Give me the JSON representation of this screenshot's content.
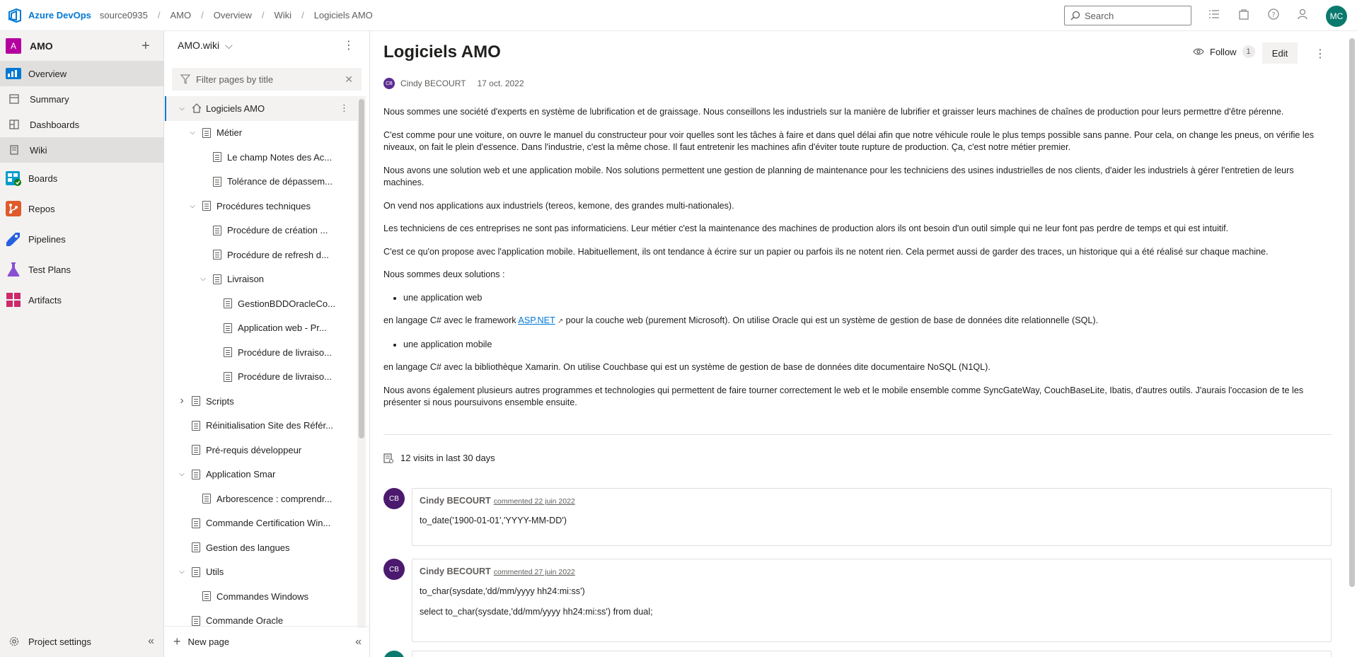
{
  "topbar": {
    "brand": "Azure DevOps",
    "breadcrumb": [
      "source0935",
      "AMO",
      "Overview",
      "Wiki",
      "Logiciels AMO"
    ],
    "search_placeholder": "Search",
    "user_initials": "MC"
  },
  "nav": {
    "project_initial": "A",
    "project_name": "AMO",
    "items": [
      {
        "label": "Overview",
        "icon": "overview-icon"
      },
      {
        "label": "Summary",
        "icon": "summary-icon"
      },
      {
        "label": "Dashboards",
        "icon": "dashboards-icon"
      },
      {
        "label": "Wiki",
        "icon": "wiki-icon"
      },
      {
        "label": "Boards",
        "icon": "boards-icon"
      },
      {
        "label": "Repos",
        "icon": "repos-icon"
      },
      {
        "label": "Pipelines",
        "icon": "pipelines-icon"
      },
      {
        "label": "Test Plans",
        "icon": "test-plans-icon"
      },
      {
        "label": "Artifacts",
        "icon": "artifacts-icon"
      }
    ],
    "project_settings": "Project settings"
  },
  "wiki": {
    "name": "AMO.wiki",
    "filter_placeholder": "Filter pages by title",
    "tree": [
      {
        "label": "Logiciels AMO",
        "indent": 0,
        "chevron": "down",
        "home": true,
        "selected": true
      },
      {
        "label": "Métier",
        "indent": 1,
        "chevron": "down"
      },
      {
        "label": "Le champ Notes des Ac...",
        "indent": 2,
        "chevron": ""
      },
      {
        "label": "Tolérance de dépassem...",
        "indent": 2,
        "chevron": ""
      },
      {
        "label": "Procédures techniques",
        "indent": 1,
        "chevron": "down"
      },
      {
        "label": "Procédure de création ...",
        "indent": 2,
        "chevron": ""
      },
      {
        "label": "Procédure de refresh d...",
        "indent": 2,
        "chevron": ""
      },
      {
        "label": "Livraison",
        "indent": 2,
        "chevron": "down"
      },
      {
        "label": "GestionBDDOracleCo...",
        "indent": 3,
        "chevron": ""
      },
      {
        "label": "Application web - Pr...",
        "indent": 3,
        "chevron": ""
      },
      {
        "label": "Procédure de livraiso...",
        "indent": 3,
        "chevron": ""
      },
      {
        "label": "Procédure de livraiso...",
        "indent": 3,
        "chevron": ""
      },
      {
        "label": "Scripts",
        "indent": 0,
        "chevron": "right"
      },
      {
        "label": "Réinitialisation Site des Référ...",
        "indent": 0,
        "chevron": ""
      },
      {
        "label": "Pré-requis développeur",
        "indent": 0,
        "chevron": ""
      },
      {
        "label": "Application Smar",
        "indent": 0,
        "chevron": "down"
      },
      {
        "label": "Arborescence : comprendr...",
        "indent": 1,
        "chevron": ""
      },
      {
        "label": "Commande Certification Win...",
        "indent": 0,
        "chevron": ""
      },
      {
        "label": "Gestion des langues",
        "indent": 0,
        "chevron": ""
      },
      {
        "label": "Utils",
        "indent": 0,
        "chevron": "down"
      },
      {
        "label": "Commandes Windows",
        "indent": 1,
        "chevron": ""
      },
      {
        "label": "Commande Oracle",
        "indent": 0,
        "chevron": ""
      }
    ],
    "new_page": "New page"
  },
  "page": {
    "title": "Logiciels AMO",
    "follow_label": "Follow",
    "follow_count": "1",
    "edit_label": "Edit",
    "author_initials": "CB",
    "author": "Cindy BECOURT",
    "date": "17 oct. 2022",
    "paragraphs": {
      "p1": "Nous sommes une société d'experts en système de lubrification et de graissage. Nous conseillons les industriels sur la manière de lubrifier et graisser leurs machines de chaînes de production pour leurs permettre d'être pérenne.",
      "p2": "C'est comme pour une voiture, on ouvre le manuel du constructeur pour voir quelles sont les tâches à faire et dans quel délai afin que notre véhicule roule le plus temps possible sans panne. Pour cela, on change les pneus, on vérifie les niveaux, on fait le plein d'essence. Dans l'industrie, c'est la même chose. Il faut entretenir les machines afin d'éviter toute rupture de production. Ça, c'est notre métier premier.",
      "p3": "Nous avons une solution web et une application mobile. Nos solutions permettent une gestion de planning de maintenance pour les techniciens des usines industrielles de nos clients, d'aider les industriels à gérer l'entretien de leurs machines.",
      "p4": "On vend nos applications aux industriels (tereos, kemone, des grandes multi-nationales).",
      "p5": "Les techniciens de ces entreprises ne sont pas informaticiens. Leur métier c'est la maintenance des machines de production alors ils ont besoin d'un outil simple qui ne leur font pas perdre de temps et qui est intuitif.",
      "p6": "C'est ce qu'on propose avec l'application mobile. Habituellement, ils ont tendance à écrire sur un papier ou parfois ils ne notent rien. Cela permet aussi de garder des traces, un historique qui a été réalisé sur chaque machine.",
      "p7": "Nous sommes deux solutions :",
      "li1": "une application web",
      "p8a": "en langage C# avec le framework ",
      "p8link": "ASP.NET",
      "p8b": " pour la couche web (purement Microsoft). On utilise Oracle qui est un système de gestion de base de données dite relationnelle (SQL).",
      "li2": "une application mobile",
      "p9": "en langage C# avec la bibliothèque Xamarin. On utilise Couchbase qui est un système de gestion de base de données dite documentaire NoSQL (N1QL).",
      "p10": "Nous avons également plusieurs autres programmes et technologies qui permettent de faire tourner correctement le web et le mobile ensemble comme SyncGateWay, CouchBaseLite, Ibatis, d'autres outils. J'aurais l'occasion de te les présenter si nous poursuivons ensemble ensuite."
    },
    "visits": "12 visits in last 30 days",
    "comments": [
      {
        "initials": "CB",
        "author": "Cindy BECOURT",
        "date": "commented 22 juin 2022",
        "lines": [
          "to_date('1900-01-01','YYYY-MM-DD')"
        ]
      },
      {
        "initials": "CB",
        "author": "Cindy BECOURT",
        "date": "commented 27 juin 2022",
        "lines": [
          "to_char(sysdate,'dd/mm/yyyy hh24:mi:ss')",
          "select to_char(sysdate,'dd/mm/yyyy hh24:mi:ss') from dual;"
        ]
      }
    ]
  }
}
